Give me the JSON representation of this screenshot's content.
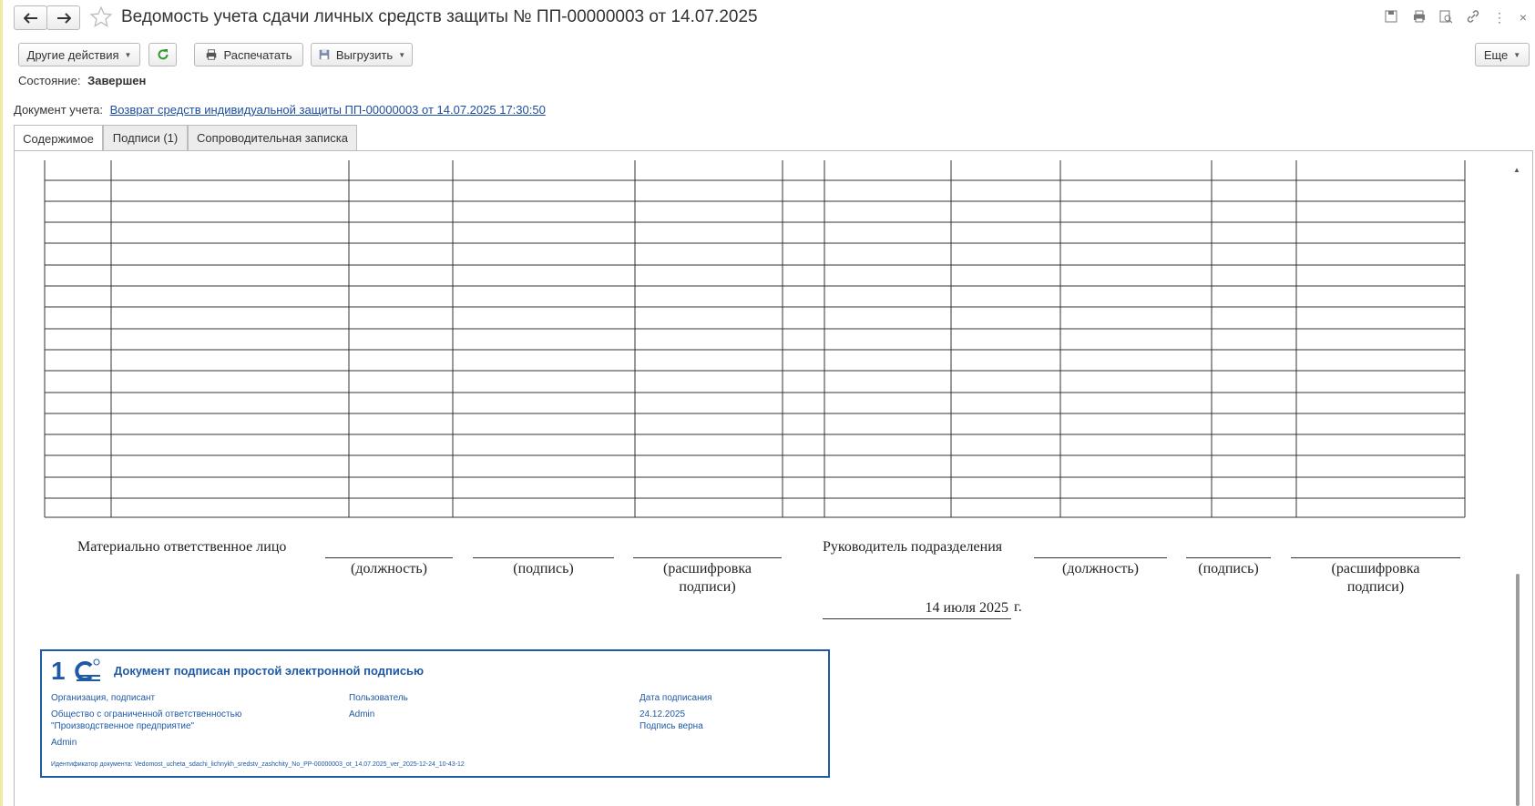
{
  "window": {
    "title": "Ведомость учета сдачи личных средств защиты № ПП-00000003 от 14.07.2025"
  },
  "toolbar": {
    "other_actions": "Другие действия",
    "print": "Распечатать",
    "export": "Выгрузить",
    "more": "Еще"
  },
  "state": {
    "label": "Состояние:",
    "value": "Завершен"
  },
  "accounting_doc": {
    "label": "Документ учета:",
    "link": "Возврат средств индивидуальной защиты ПП-00000003 от 14.07.2025 17:30:50"
  },
  "tabs": [
    {
      "label": "Содержимое",
      "active": true
    },
    {
      "label": "Подписи (1)",
      "active": false
    },
    {
      "label": "Сопроводительная записка",
      "active": false
    }
  ],
  "document": {
    "mol_label": "Материально ответственное лицо",
    "head_label": "Руководитель подразделения",
    "position": "(должность)",
    "signature": "(подпись)",
    "decoding_1": "(расшифровка",
    "decoding_2": "подписи)",
    "date": "14 июля 2025",
    "date_suffix": "г."
  },
  "stamp": {
    "logo": "1С",
    "title": "Документ подписан простой электронной подписью",
    "org_label": "Организация, подписант",
    "org_value_1": "Общество с ограниченной ответственностью",
    "org_value_2": "\"Производственное предприятие\"",
    "org_signer": "Admin",
    "user_label": "Пользователь",
    "user_value": "Admin",
    "date_label": "Дата подписания",
    "date_value": "24.12.2025",
    "sig_status": "Подпись верна",
    "doc_id": "Идентификатор документа: Vedomost_ucheta_sdachi_lichnykh_sredstv_zashchity_No_PP-00000003_ot_14.07.2025_ver_2025-12-24_10-43-12"
  },
  "colors": {
    "stamp_blue": "#1f5aa6",
    "link_blue": "#1c4fa0",
    "refresh_green": "#2e9a2e"
  }
}
